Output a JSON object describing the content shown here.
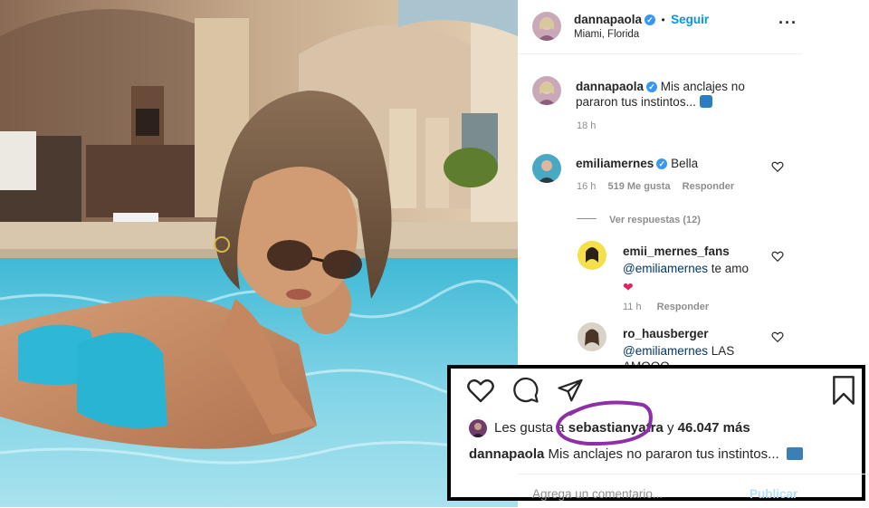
{
  "header": {
    "username": "dannapaola",
    "verified": true,
    "follow_label": "Seguir",
    "separator": "•",
    "location": "Miami, Florida",
    "more_icon": "more-horizontal-icon"
  },
  "caption": {
    "username": "dannapaola",
    "text": "Mis anclajes no pararon tus instintos...",
    "emoji": "wave-emoji",
    "time": "18 h"
  },
  "comments": [
    {
      "username": "emiliamernes",
      "verified": true,
      "text": "Bella",
      "time": "16 h",
      "likes": "519 Me gusta",
      "reply_label": "Responder",
      "view_replies": "Ver respuestas (12)"
    },
    {
      "username": "emii_mernes_fans",
      "mention": "@emiliamernes",
      "text": "te amo",
      "emoji": "red-heart-emoji",
      "time": "11 h",
      "reply_label": "Responder"
    },
    {
      "username": "ro_hausberger",
      "mention": "@emiliamernes",
      "text": "LAS",
      "text2": "AMOOO"
    }
  ],
  "overlay": {
    "likes_prefix": "Les gusta a",
    "liker": "sebastianyatra",
    "likes_suffix": "y",
    "likes_count": "46.047 más",
    "caption_user": "dannapaola",
    "caption_text": "Mis anclajes no pararon tus instintos...",
    "icons": [
      "heart-icon",
      "comment-icon",
      "share-icon",
      "bookmark-icon"
    ],
    "highlight_color": "#8f2fa8"
  },
  "footer": {
    "placeholder": "Agrega un comentario...",
    "publish_label": "Publicar"
  },
  "colors": {
    "link_blue": "#0095f6",
    "verified_blue": "#3897f0",
    "muted": "#8e8e8e"
  }
}
